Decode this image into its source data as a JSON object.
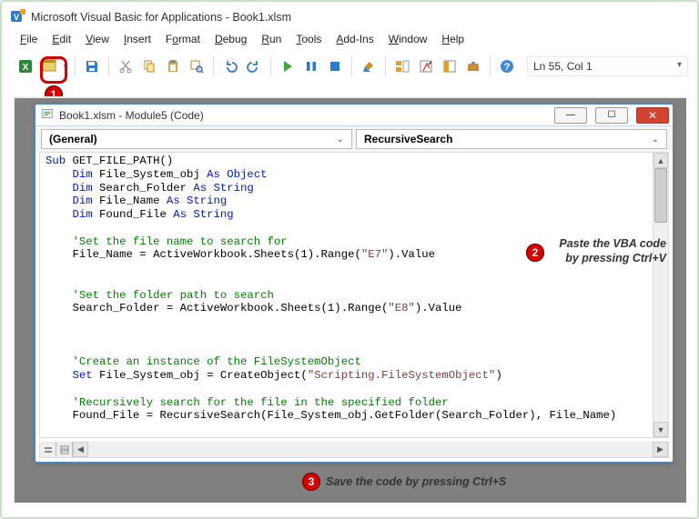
{
  "app": {
    "title": "Microsoft Visual Basic for Applications - Book1.xlsm"
  },
  "menu": {
    "file": {
      "label": "File",
      "accel": "F"
    },
    "edit": {
      "label": "Edit",
      "accel": "E"
    },
    "view": {
      "label": "View",
      "accel": "V"
    },
    "insert": {
      "label": "Insert",
      "accel": "I"
    },
    "format": {
      "label": "Format",
      "accel": "o"
    },
    "debug": {
      "label": "Debug",
      "accel": "D"
    },
    "run": {
      "label": "Run",
      "accel": "R"
    },
    "tools": {
      "label": "Tools",
      "accel": "T"
    },
    "addins": {
      "label": "Add-Ins",
      "accel": "A"
    },
    "window": {
      "label": "Window",
      "accel": "W"
    },
    "help": {
      "label": "Help",
      "accel": "H"
    }
  },
  "toolbar": {
    "cursor_pos": "Ln 55, Col 1"
  },
  "codewin": {
    "title": "Book1.xlsm - Module5 (Code)",
    "left_dd": "(General)",
    "right_dd": "RecursiveSearch"
  },
  "callouts": {
    "n1": "1",
    "n2": "2",
    "t2a": "Paste the VBA code",
    "t2b": "by pressing Ctrl+V",
    "n3": "3",
    "t3": "Save the code by pressing Ctrl+S"
  },
  "code": {
    "l01a": "Sub ",
    "l01b": "GET_FILE_PATH()",
    "l02a": "    Dim ",
    "l02b": "File_System_obj ",
    "l02c": "As Object",
    "l03a": "    Dim ",
    "l03b": "Search_Folder ",
    "l03c": "As String",
    "l04a": "    Dim ",
    "l04b": "File_Name ",
    "l04c": "As String",
    "l05a": "    Dim ",
    "l05b": "Found_File ",
    "l05c": "As String",
    "c07": "    'Set the file name to search for",
    "l08a": "    File_Name = ActiveWorkbook.Sheets(1).Range(",
    "l08s": "\"E7\"",
    "l08b": ").Value",
    "c11": "    'Set the folder path to search",
    "l12a": "    Search_Folder = ActiveWorkbook.Sheets(1).Range(",
    "l12s": "\"E8\"",
    "l12b": ").Value",
    "c16": "    'Create an instance of the FileSystemObject",
    "l17a": "    Set ",
    "l17b": "File_System_obj = CreateObject(",
    "l17s": "\"Scripting.FileSystemObject\"",
    "l17c": ")",
    "c19": "    'Recursively search for the file in the specified folder",
    "l20": "    Found_File = RecursiveSearch(File_System_obj.GetFolder(Search_Folder), File_Name)"
  }
}
